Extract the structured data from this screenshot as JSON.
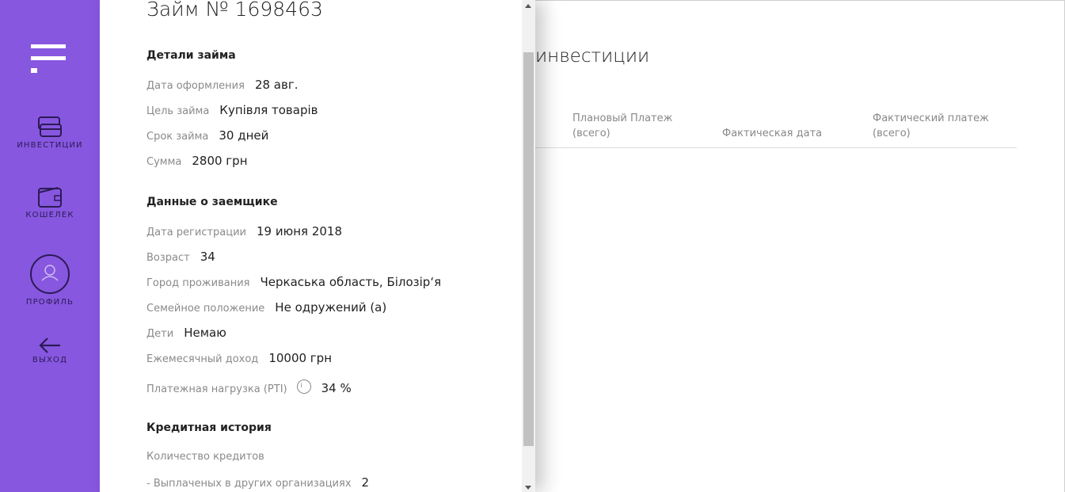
{
  "sidebar": {
    "items": [
      {
        "label": "ИНВЕСТИЦИИ",
        "icon": "investments-icon"
      },
      {
        "label": "КОШЕЛЕК",
        "icon": "wallet-icon"
      },
      {
        "label": "ПРОФИЛЬ",
        "icon": "profile-icon"
      },
      {
        "label": "ВЫХОД",
        "icon": "exit-arrow-icon"
      }
    ],
    "color": "#8757e0"
  },
  "main": {
    "title_partial": "инвестиции",
    "columns": [
      "Плановый Платеж\n(всего)",
      "Фактическая дата",
      "Фактический платеж\n(всего)"
    ]
  },
  "panel": {
    "title": "Займ № 1698463",
    "loan_details": {
      "heading": "Детали займа",
      "rows": [
        {
          "label": "Дата оформления",
          "value": "28 авг."
        },
        {
          "label": "Цель займа",
          "value": "Купівля товарів"
        },
        {
          "label": "Срок займа",
          "value": "30 дней"
        },
        {
          "label": "Сумма",
          "value": "2800 грн"
        }
      ]
    },
    "borrower": {
      "heading": "Данные о заемщике",
      "rows": [
        {
          "label": "Дата регистрации",
          "value": "19 июня 2018"
        },
        {
          "label": "Возраст",
          "value": "34"
        },
        {
          "label": "Город проживания",
          "value": "Черкаська область, Білозір‘я"
        },
        {
          "label": "Семейное положение",
          "value": "Не одружений (а)"
        },
        {
          "label": "Дети",
          "value": "Немаю"
        },
        {
          "label": "Ежемесячный доход",
          "value": "10000 грн"
        },
        {
          "label": "Платежная нагрузка (PTI)",
          "value": "34 %",
          "info": "i"
        }
      ]
    },
    "credit_history": {
      "heading": "Кредитная история",
      "rows": [
        {
          "label": "Количество кредитов",
          "value": ""
        },
        {
          "label": "- Выплаченых в других организациях",
          "value": "2"
        }
      ]
    }
  }
}
